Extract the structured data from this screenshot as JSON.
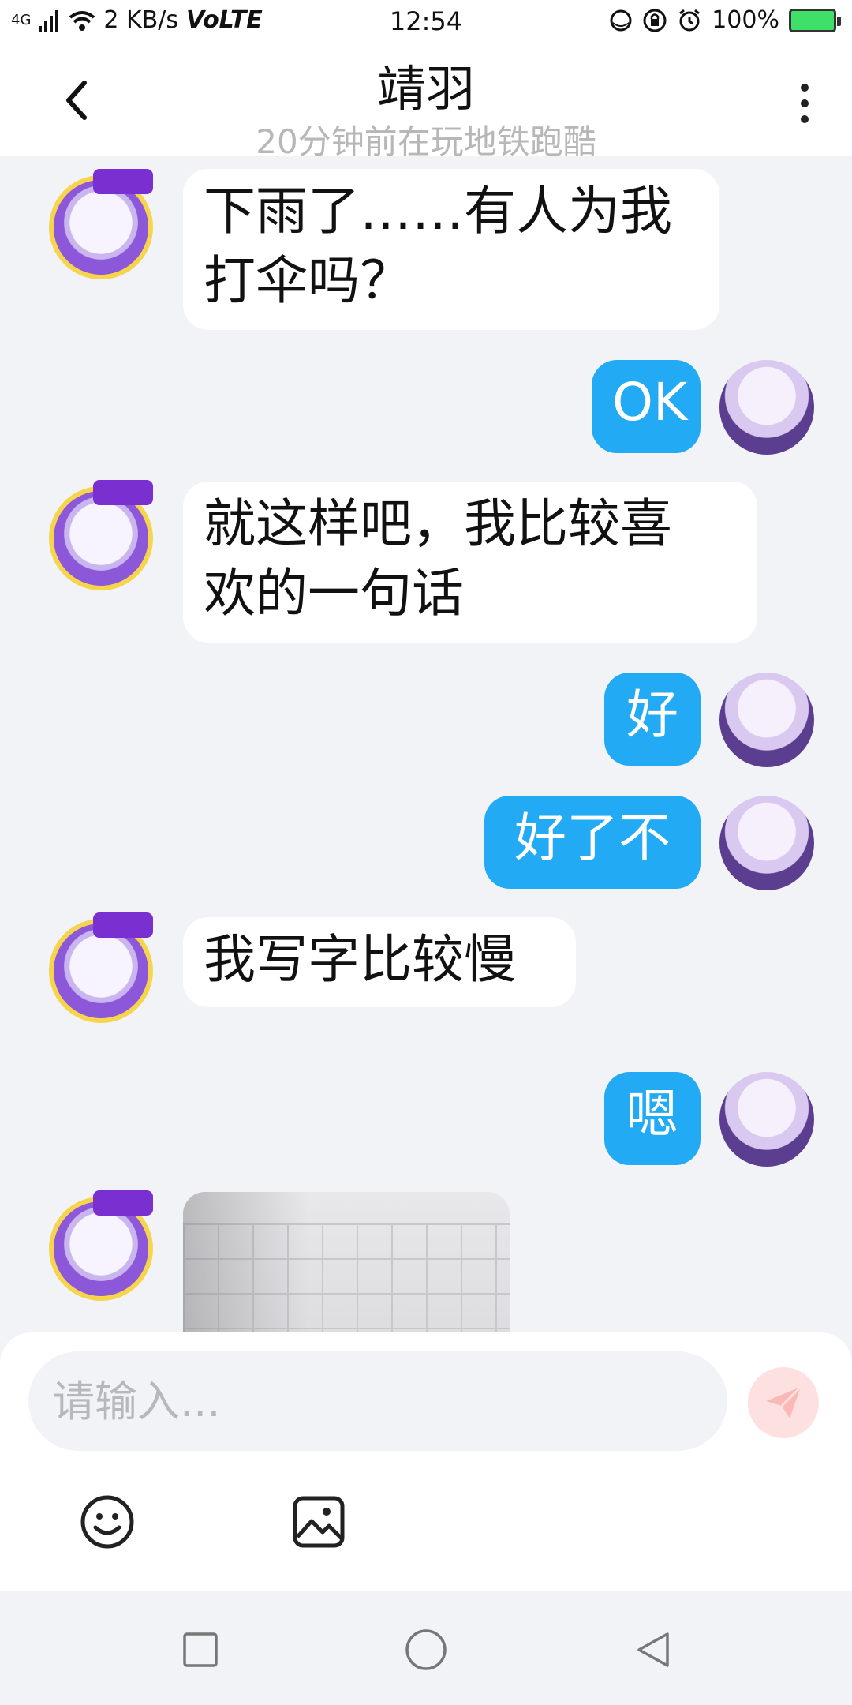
{
  "status_bar": {
    "network_type": "4G",
    "speed": "2 KB/s",
    "volte": "VoLTE",
    "time": "12:54",
    "battery": "100%"
  },
  "header": {
    "title": "靖羽",
    "subtitle": "20分钟前在玩地铁跑酷"
  },
  "messages": [
    {
      "side": "in",
      "text": "下雨了……有人为我打伞吗？",
      "line1": "下雨了……有人为我",
      "line2": "打伞吗？"
    },
    {
      "side": "out",
      "text": "OK"
    },
    {
      "side": "in",
      "text": "就这样吧，我比较喜欢的一句话",
      "line1": "就这样吧，我比较喜",
      "line2": "欢的一句话"
    },
    {
      "side": "out",
      "text": "好"
    },
    {
      "side": "out",
      "text": "好了不"
    },
    {
      "side": "in",
      "text": "我写字比较慢"
    },
    {
      "side": "out",
      "text": "嗯"
    },
    {
      "side": "in",
      "type": "image"
    }
  ],
  "composer": {
    "placeholder": "请输入..."
  },
  "icons": {
    "back": "chevron-left-icon",
    "more": "more-vertical-icon",
    "send": "send-icon",
    "emoji": "emoji-icon",
    "image": "image-icon",
    "nav_recent": "square-icon",
    "nav_home": "circle-icon",
    "nav_back": "triangle-back-icon"
  },
  "colors": {
    "outgoing_bubble": "#22aaf4",
    "incoming_bubble": "#ffffff",
    "background": "#f2f3f6",
    "send_button": "#fde1e0"
  }
}
